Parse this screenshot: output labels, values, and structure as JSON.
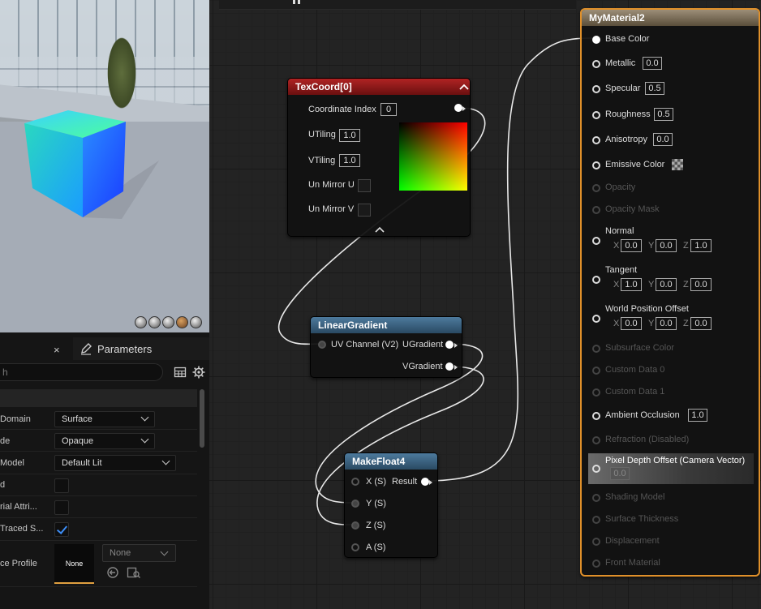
{
  "details": {
    "close_glyph": "×",
    "parameters_tab": "Parameters",
    "search_placeholder": "h",
    "rows": [
      {
        "label": "Domain",
        "value": "Surface",
        "kind": "combo"
      },
      {
        "label": "de",
        "value": "Opaque",
        "kind": "combo"
      },
      {
        "label": "Model",
        "value": "Default Lit",
        "kind": "combo"
      },
      {
        "label": "d",
        "value": "",
        "kind": "check"
      },
      {
        "label": "rial Attri...",
        "value": "",
        "kind": "check"
      },
      {
        "label": "Traced S...",
        "value": "",
        "kind": "check-on"
      },
      {
        "label": "ce Profile",
        "value": "None",
        "kind": "profile"
      }
    ],
    "profile_thumb": "None",
    "profile_combo": "None"
  },
  "texcoord": {
    "title": "TexCoord[0]",
    "coord_index_label": "Coordinate Index",
    "coord_index_value": "0",
    "utiling_label": "UTiling",
    "utiling_value": "1.0",
    "vtiling_label": "VTiling",
    "vtiling_value": "1.0",
    "unmirror_u": "Un Mirror U",
    "unmirror_v": "Un Mirror V"
  },
  "linear_gradient": {
    "title": "LinearGradient",
    "input": "UV Channel (V2)",
    "out_u": "UGradient",
    "out_v": "VGradient"
  },
  "makefloat4": {
    "title": "MakeFloat4",
    "x": "X (S)",
    "y": "Y (S)",
    "z": "Z (S)",
    "a": "A (S)",
    "result": "Result"
  },
  "material": {
    "title": "MyMaterial2",
    "base_color": "Base Color",
    "metallic": "Metallic",
    "metallic_v": "0.0",
    "specular": "Specular",
    "specular_v": "0.5",
    "roughness": "Roughness",
    "roughness_v": "0.5",
    "anisotropy": "Anisotropy",
    "anisotropy_v": "0.0",
    "emissive": "Emissive Color",
    "opacity": "Opacity",
    "opacity_mask": "Opacity Mask",
    "normal": "Normal",
    "normal_x": "0.0",
    "normal_y": "0.0",
    "normal_z": "1.0",
    "tangent": "Tangent",
    "tangent_x": "1.0",
    "tangent_y": "0.0",
    "tangent_z": "0.0",
    "wpo": "World Position Offset",
    "wpo_x": "0.0",
    "wpo_y": "0.0",
    "wpo_z": "0.0",
    "subsurface": "Subsurface Color",
    "custom0": "Custom Data 0",
    "custom1": "Custom Data 1",
    "ao": "Ambient Occlusion",
    "ao_v": "1.0",
    "refraction": "Refraction (Disabled)",
    "pdo": "Pixel Depth Offset (Camera Vector)",
    "pdo_v": "0.0",
    "shading_model": "Shading Model",
    "surface_thickness": "Surface Thickness",
    "displacement": "Displacement",
    "front_material": "Front Material",
    "axis_x": "X",
    "axis_y": "Y",
    "axis_z": "Z"
  }
}
